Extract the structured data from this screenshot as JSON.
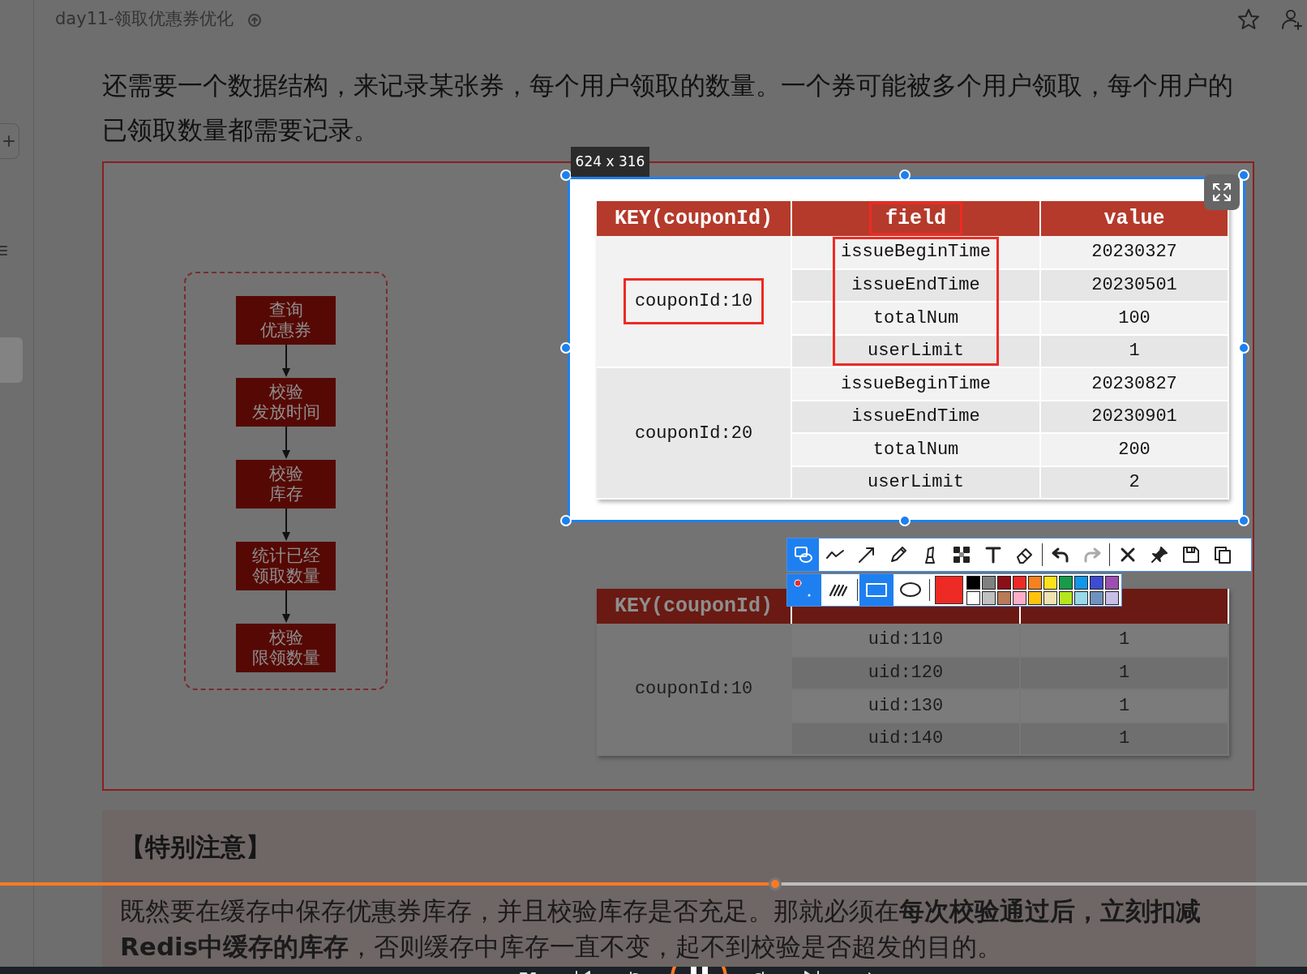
{
  "document": {
    "title": "day11-领取优惠券优化",
    "paragraph": "还需要一个数据结构，来记录某张券，每个用户领取的数量。一个券可能被多个用户领取，每个用户的已领取数量都需要记录。"
  },
  "figure": {
    "flow_steps": [
      {
        "lines": [
          "查询",
          "优惠券"
        ]
      },
      {
        "lines": [
          "校验",
          "发放时间"
        ]
      },
      {
        "lines": [
          "校验",
          "库存"
        ]
      },
      {
        "lines": [
          "统计已经",
          "领取数量"
        ]
      },
      {
        "lines": [
          "校验",
          "限领数量"
        ]
      }
    ],
    "selection": {
      "size_label": "624 x 316",
      "hash_table": {
        "columns": [
          {
            "label": "KEY(couponId)",
            "boxed": false
          },
          {
            "label": "field",
            "boxed": true
          },
          {
            "label": "value",
            "boxed": false
          }
        ],
        "groups": [
          {
            "key": "couponId:10",
            "key_boxed": true,
            "fields_boxed": true,
            "rows": [
              {
                "field": "issueBeginTime",
                "value": "20230327"
              },
              {
                "field": "issueEndTime",
                "value": "20230501"
              },
              {
                "field": "totalNum",
                "value": "100"
              },
              {
                "field": "userLimit",
                "value": "1"
              }
            ]
          },
          {
            "key": "couponId:20",
            "key_boxed": false,
            "fields_boxed": false,
            "rows": [
              {
                "field": "issueBeginTime",
                "value": "20230827"
              },
              {
                "field": "issueEndTime",
                "value": "20230901"
              },
              {
                "field": "totalNum",
                "value": "200"
              },
              {
                "field": "userLimit",
                "value": "2"
              }
            ]
          }
        ]
      }
    },
    "count_table": {
      "columns": [
        {
          "label": "KEY(couponId)"
        }
      ],
      "key": "couponId:10",
      "rows": [
        {
          "field": "uid:110",
          "value": "1"
        },
        {
          "field": "uid:120",
          "value": "1"
        },
        {
          "field": "uid:130",
          "value": "1"
        },
        {
          "field": "uid:140",
          "value": "1"
        }
      ]
    }
  },
  "screenshot_toolbar": {
    "tools": [
      {
        "kind": "shape",
        "selected": true
      },
      {
        "kind": "polyline",
        "selected": false
      },
      {
        "kind": "arrow",
        "selected": false
      },
      {
        "kind": "pencil",
        "selected": false
      },
      {
        "kind": "marker",
        "selected": false
      },
      {
        "kind": "mosaic",
        "selected": false
      },
      {
        "kind": "text",
        "selected": false
      },
      {
        "kind": "eraser",
        "selected": false
      }
    ],
    "actions": [
      {
        "kind": "undo",
        "disabled": false
      },
      {
        "kind": "redo",
        "disabled": true
      },
      {
        "kind": "close",
        "disabled": false
      },
      {
        "kind": "pin",
        "disabled": false
      },
      {
        "kind": "save",
        "disabled": false
      },
      {
        "kind": "copy",
        "disabled": false
      }
    ],
    "options": [
      {
        "kind": "size",
        "selected": true
      },
      {
        "kind": "fill",
        "selected": false
      },
      {
        "kind": "rectangle",
        "selected": true
      },
      {
        "kind": "ellipse",
        "selected": false
      }
    ],
    "palette": [
      {
        "color": "#000000",
        "selected": false
      },
      {
        "color": "#808080",
        "selected": false
      },
      {
        "color": "#8b0f16",
        "selected": false
      },
      {
        "color": "#ee2a24",
        "selected": true
      },
      {
        "color": "#f5821f",
        "selected": false
      },
      {
        "color": "#ffe11b",
        "selected": false
      },
      {
        "color": "#179b48",
        "selected": false
      },
      {
        "color": "#1296e8",
        "selected": false
      },
      {
        "color": "#3f4bd0",
        "selected": false
      },
      {
        "color": "#9c4fb0",
        "selected": false
      },
      {
        "color": "#ffffff",
        "selected": false
      },
      {
        "color": "#c0c0c0",
        "selected": false
      },
      {
        "color": "#b97a57",
        "selected": false
      },
      {
        "color": "#ffaec9",
        "selected": false
      },
      {
        "color": "#ffc20e",
        "selected": false
      },
      {
        "color": "#efe4b0",
        "selected": false
      },
      {
        "color": "#b5e61d",
        "selected": false
      },
      {
        "color": "#99d9ea",
        "selected": false
      },
      {
        "color": "#7092be",
        "selected": false
      },
      {
        "color": "#c8bfe7",
        "selected": false
      }
    ]
  },
  "note": {
    "title": "【特别注意】",
    "text": "既然要在缓存中保存优惠券库存，并且校验库存是否充足。那就必须在**每次校验通过后，立刻扣减Redis中缓存的库存**，否则缓存中库存一直不变，起不到校验是否超发的目的。"
  },
  "player": {
    "playing": true,
    "progress": {
      "level": 0.593
    }
  }
}
